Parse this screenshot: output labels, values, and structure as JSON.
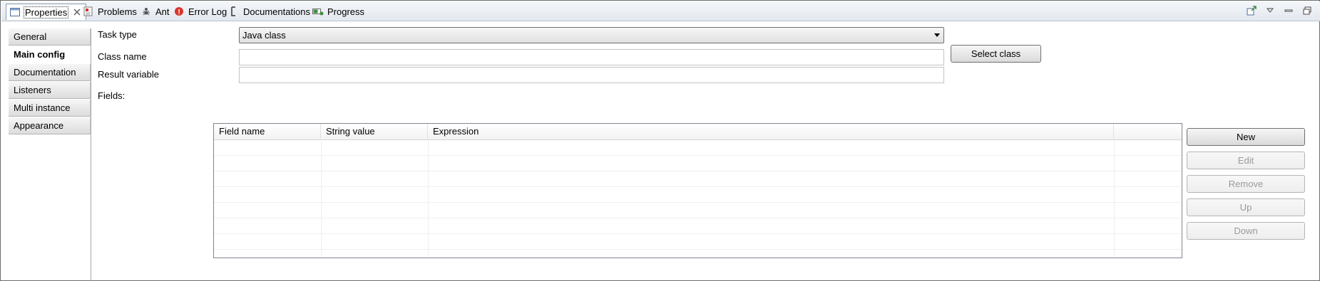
{
  "tabs": [
    {
      "label": "Properties",
      "icon": "properties-icon",
      "active": true
    },
    {
      "label": "Problems",
      "icon": "problems-icon"
    },
    {
      "label": "Ant",
      "icon": "ant-icon"
    },
    {
      "label": "Error Log",
      "icon": "error-log-icon"
    },
    {
      "label": "Documentations",
      "icon": "documentations-icon"
    },
    {
      "label": "Progress",
      "icon": "progress-icon"
    }
  ],
  "sidebar": {
    "items": [
      {
        "label": "General"
      },
      {
        "label": "Main config",
        "selected": true
      },
      {
        "label": "Documentation"
      },
      {
        "label": "Listeners"
      },
      {
        "label": "Multi instance"
      },
      {
        "label": "Appearance"
      }
    ]
  },
  "form": {
    "task_type_label": "Task type",
    "task_type_value": "Java class",
    "class_name_label": "Class name",
    "class_name_value": "",
    "select_class_label": "Select class",
    "result_variable_label": "Result variable",
    "result_variable_value": "",
    "fields_label": "Fields:"
  },
  "fields_table": {
    "columns": [
      "Field name",
      "String value",
      "Expression",
      ""
    ],
    "rows": []
  },
  "table_buttons": {
    "new": "New",
    "edit": "Edit",
    "remove": "Remove",
    "up": "Up",
    "down": "Down"
  },
  "colors": {
    "accent_tab_border": "#8a9bb1",
    "error_icon": "#d9342b",
    "progress_icon": "#3c8d3c"
  }
}
